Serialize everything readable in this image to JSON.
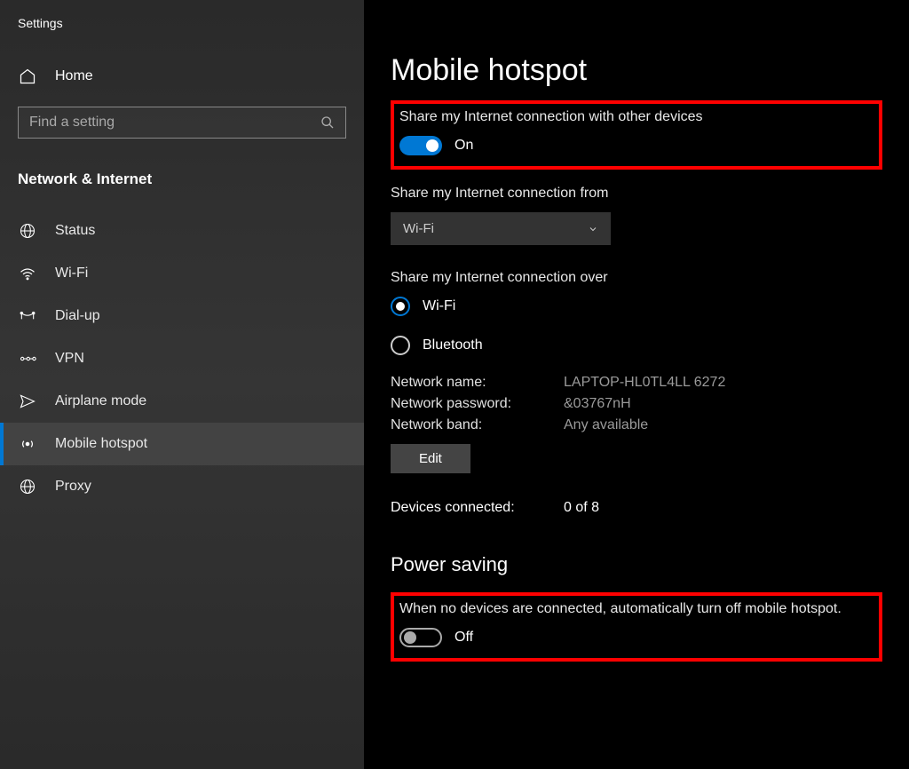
{
  "sidebar": {
    "title": "Settings",
    "home_label": "Home",
    "search_placeholder": "Find a setting",
    "category": "Network & Internet",
    "items": [
      {
        "label": "Status",
        "icon": "globe"
      },
      {
        "label": "Wi-Fi",
        "icon": "wifi"
      },
      {
        "label": "Dial-up",
        "icon": "dialup"
      },
      {
        "label": "VPN",
        "icon": "vpn"
      },
      {
        "label": "Airplane mode",
        "icon": "airplane"
      },
      {
        "label": "Mobile hotspot",
        "icon": "hotspot",
        "active": true
      },
      {
        "label": "Proxy",
        "icon": "proxy"
      }
    ]
  },
  "main": {
    "title": "Mobile hotspot",
    "share_label": "Share my Internet connection with other devices",
    "share_toggle": {
      "state": "on",
      "status": "On"
    },
    "from_label": "Share my Internet connection from",
    "from_value": "Wi-Fi",
    "over_label": "Share my Internet connection over",
    "over_options": [
      {
        "label": "Wi-Fi",
        "selected": true
      },
      {
        "label": "Bluetooth",
        "selected": false
      }
    ],
    "network": {
      "name_label": "Network name:",
      "name_value": "LAPTOP-HL0TL4LL 6272",
      "password_label": "Network password:",
      "password_value": "&03767nH",
      "band_label": "Network band:",
      "band_value": "Any available",
      "edit_label": "Edit"
    },
    "devices": {
      "label": "Devices connected:",
      "value": "0 of 8"
    },
    "power": {
      "heading": "Power saving",
      "label": "When no devices are connected, automatically turn off mobile hotspot.",
      "toggle": {
        "state": "off",
        "status": "Off"
      }
    }
  }
}
